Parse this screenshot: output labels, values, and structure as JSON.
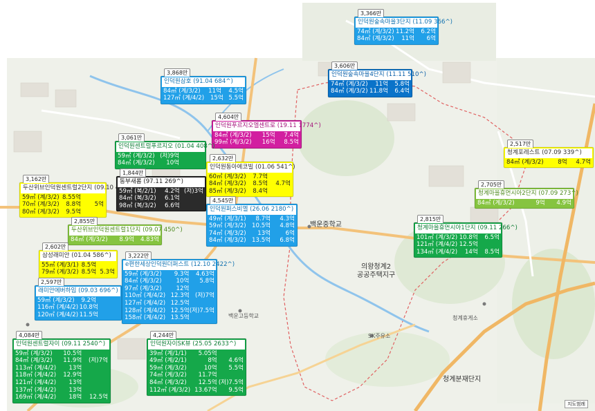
{
  "map_labels": [
    {
      "id": "school-baekun-middle",
      "text": "백운중학교"
    },
    {
      "id": "district-cheonggye2",
      "text": "의왕청계2"
    },
    {
      "id": "district-cheonggye2b",
      "text": "공공주택지구"
    },
    {
      "id": "district-cheonggyebunjae",
      "text": "청계분재단지"
    },
    {
      "id": "school-baekungo",
      "text": "백운고등학교"
    },
    {
      "id": "sk-station",
      "text": "SK주유소"
    },
    {
      "id": "rest-area",
      "text": "청계휴게소"
    }
  ],
  "scale_label": "지도범례",
  "callouts": [
    {
      "id": "c3366",
      "count": "3,366만",
      "title": "인덕원숲속마을3단지 (11.09 366^)",
      "color": "blue",
      "rows": [
        [
          "74㎡ (계/3/2)",
          "11.2억",
          "6.2억"
        ],
        [
          "84㎡ (계/3/2)",
          "11억",
          "6억"
        ]
      ]
    },
    {
      "id": "c3606",
      "count": "3,606만",
      "title": "인덕원숲속마을4단지 (11.11 510^)",
      "color": "dblue",
      "rows": [
        [
          "74㎡ (계/3/2)",
          "11억",
          "5.8억"
        ],
        [
          "84㎡ (계/3/2)",
          "11.8억",
          "6.4억"
        ]
      ]
    },
    {
      "id": "c3868",
      "count": "3,868만",
      "title": "인덕원삼호 (91.04 684^)",
      "color": "blue",
      "rows": [
        [
          "84㎡ (계/3/2)",
          "11억",
          "4.5억"
        ],
        [
          "127㎡ (계/4/2)",
          "15억",
          "5.5억"
        ]
      ]
    },
    {
      "id": "c4604",
      "count": "4,604만",
      "title": "인덕원푸르지오엘센트로 (19.11 1774^)",
      "color": "magenta",
      "rows": [
        [
          "84㎡ (계/3/2)",
          "15억",
          "7.4억"
        ],
        [
          "99㎡ (계/3/2)",
          "16억",
          "8.5억"
        ]
      ]
    },
    {
      "id": "c3061",
      "count": "3,061만",
      "title": "인덕원센트럴푸르지오 (01.04 408^)",
      "color": "green",
      "rows": [
        [
          "59㎡ (계/3/2)",
          "(저)9억",
          ""
        ],
        [
          "84㎡ (계/3/2)",
          "10억",
          ""
        ]
      ]
    },
    {
      "id": "c2632",
      "count": "2,632만",
      "title": "인덕원동아에코빌 (01.06 541^)",
      "color": "yellow",
      "rows": [
        [
          "60㎡ (계/3/2)",
          "7.7억",
          ""
        ],
        [
          "84㎡ (계/3/2)",
          "8.5억",
          "4.7억"
        ],
        [
          "85㎡ (계/3/2)",
          "8.4억",
          ""
        ]
      ]
    },
    {
      "id": "c2517",
      "count": "2,517만",
      "title": "청계포레스트 (07.09 339^)",
      "color": "yellow",
      "rows": [
        [
          "84㎡ (계/3/2)",
          "8억",
          "4.7억"
        ]
      ]
    },
    {
      "id": "c3162",
      "count": "3,162만",
      "title": "두산위브인덕원센트럴2단지 (09.10 447^)",
      "color": "yellow",
      "rows": [
        [
          "59㎡ (계/3/2)",
          "8.55억",
          ""
        ],
        [
          "70㎡ (계/3/2)",
          "8.8억",
          "5억"
        ],
        [
          "80㎡ (계/3/2)",
          "9.5억",
          ""
        ]
      ]
    },
    {
      "id": "c1844",
      "count": "1,844만",
      "title": "동부새롬 (97.11 269^)",
      "color": "dark",
      "rows": [
        [
          "59㎡ (복/2/1)",
          "4.2억",
          "(저)3억"
        ],
        [
          "84㎡ (복/3/2)",
          "6.1억",
          ""
        ],
        [
          "98㎡ (복/3/2)",
          "6.6억",
          ""
        ]
      ]
    },
    {
      "id": "c2705",
      "count": "2,705만",
      "title": "청계마을휴먼시아2단지 (07.09 273^)",
      "color": "lgreen",
      "rows": [
        [
          "84㎡ (계/3/2)",
          "9억",
          "4.9억"
        ]
      ]
    },
    {
      "id": "c4545",
      "count": "4,545만",
      "title": "인덕원퍼스비엘 (26.06 2180^)",
      "color": "blue",
      "rows": [
        [
          "49㎡ (계/3/1)",
          "8.7억",
          "4.3억"
        ],
        [
          "59㎡ (계/3/2)",
          "10.5억",
          "4.8억"
        ],
        [
          "74㎡ (계/3/2)",
          "13억",
          "6억"
        ],
        [
          "84㎡ (계/3/2)",
          "13.5억",
          "6.8억"
        ]
      ]
    },
    {
      "id": "c2855",
      "count": "2,855만",
      "title": "두산위브인덕원센트럴1단지 (09.07 450^)",
      "color": "lgreen",
      "rows": [
        [
          "84㎡ (계/3/2)",
          "8.9억",
          "4.83억"
        ]
      ]
    },
    {
      "id": "c2815",
      "count": "2,815만",
      "title": "청계마을휴먼시아1단지 (09.11 266^)",
      "color": "green",
      "rows": [
        [
          "101㎡ (계/3/2)",
          "10.8억",
          "6.5억"
        ],
        [
          "121㎡ (계/4/2)",
          "12.5억",
          ""
        ],
        [
          "134㎡ (계/4/2)",
          "14억",
          "8.5억"
        ]
      ]
    },
    {
      "id": "c2602",
      "count": "2,602만",
      "title": "삼성래미안 (01.04 586^)",
      "color": "yellow",
      "rows": [
        [
          "55㎡ (계/3/1)",
          "8.5억",
          ""
        ],
        [
          "79㎡ (계/3/2)",
          "8.5억",
          "5.3억"
        ]
      ]
    },
    {
      "id": "c3222",
      "count": "3,222만",
      "title": "e편한세상인덕원더퍼스트 (12.10 2422^)",
      "color": "blue",
      "rows": [
        [
          "59㎡ (계/3/2)",
          "9.3억",
          "4.63억"
        ],
        [
          "84㎡ (계/3/2)",
          "10억",
          "5.8억"
        ],
        [
          "97㎡ (계/3/2)",
          "12억",
          ""
        ],
        [
          "110㎡ (계/4/2)",
          "12.3억",
          "(저)7억"
        ],
        [
          "127㎡ (계/4/2)",
          "12.5억",
          ""
        ],
        [
          "128㎡ (계/4/2)",
          "12.5억",
          "(저)7.5억"
        ],
        [
          "158㎡ (계/4/2)",
          "13.5억",
          ""
        ]
      ]
    },
    {
      "id": "c2597",
      "count": "2,597만",
      "title": "래미안에버하임 (09.03 696^)",
      "color": "blue",
      "rows": [
        [
          "59㎡ (계/3/2)",
          "9.2억",
          ""
        ],
        [
          "116㎡ (계/4/2)",
          "10.8억",
          ""
        ],
        [
          "120㎡ (계/4/2)",
          "11.5억",
          ""
        ]
      ]
    },
    {
      "id": "c4084",
      "count": "4,084만",
      "title": "인덕원센트럴자이 (09.11 2540^)",
      "color": "green",
      "rows": [
        [
          "59㎡ (계/3/2)",
          "10.5억",
          ""
        ],
        [
          "84㎡ (계/3/2)",
          "11.9억",
          "(저)7억"
        ],
        [
          "113㎡ (계/4/2)",
          "13억",
          ""
        ],
        [
          "118㎡ (계/4/2)",
          "12.9억",
          ""
        ],
        [
          "121㎡ (계/4/2)",
          "13억",
          ""
        ],
        [
          "137㎡ (계/4/2)",
          "13억",
          ""
        ],
        [
          "169㎡ (계/4/2)",
          "18억",
          "12.5억"
        ]
      ]
    },
    {
      "id": "c4244",
      "count": "4,244만",
      "title": "인덕원자이SK뷰 (25.05 2633^)",
      "color": "green",
      "rows": [
        [
          "39㎡ (계/1/1)",
          "5.05억",
          ""
        ],
        [
          "49㎡ (계/2/1)",
          "8억",
          "4.6억"
        ],
        [
          "59㎡ (계/3/2)",
          "10억",
          "5.5억"
        ],
        [
          "74㎡ (계/3/2)",
          "11.7억",
          ""
        ],
        [
          "84㎡ (계/3/2)",
          "12.5억",
          "(저)7.5억"
        ],
        [
          "112㎡ (계/3/2)",
          "13.67억",
          "9.5억"
        ]
      ]
    }
  ]
}
